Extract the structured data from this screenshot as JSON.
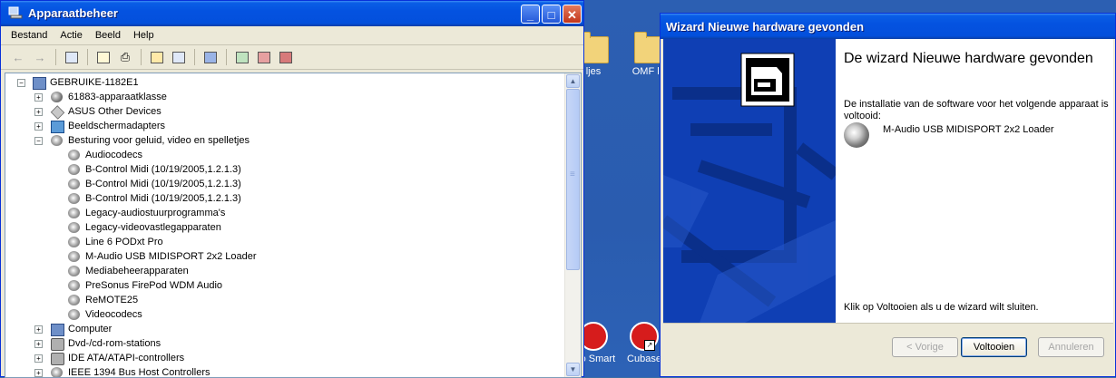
{
  "desktop": {
    "icons": [
      {
        "label": "ljes"
      },
      {
        "label": "OMF lie"
      },
      {
        "label": "ero Smart"
      },
      {
        "label": "Cubase"
      }
    ]
  },
  "devmgr": {
    "title": "Apparaatbeheer",
    "menu": [
      "Bestand",
      "Actie",
      "Beeld",
      "Help"
    ],
    "tree": {
      "root": "GEBRUIKE-1182E1",
      "items": [
        {
          "label": "61883-apparaatklasse",
          "expanded": false
        },
        {
          "label": "ASUS Other Devices",
          "expanded": false
        },
        {
          "label": "Beeldschermadapters",
          "expanded": false
        },
        {
          "label": "Besturing voor geluid, video en spelletjes",
          "expanded": true,
          "children": [
            "Audiocodecs",
            "B-Control Midi (10/19/2005,1.2.1.3)",
            "B-Control Midi (10/19/2005,1.2.1.3)",
            "B-Control Midi (10/19/2005,1.2.1.3)",
            "Legacy-audiostuurprogramma's",
            "Legacy-videovastlegapparaten",
            "Line 6 PODxt Pro",
            "M-Audio USB MIDISPORT 2x2 Loader",
            "Mediabeheerapparaten",
            "PreSonus FirePod WDM Audio",
            "ReMOTE25",
            "Videocodecs"
          ]
        },
        {
          "label": "Computer",
          "expanded": false
        },
        {
          "label": "Dvd-/cd-rom-stations",
          "expanded": false
        },
        {
          "label": "IDE ATA/ATAPI-controllers",
          "expanded": false
        },
        {
          "label": "IEEE 1394 Bus Host Controllers",
          "expanded": false
        }
      ]
    }
  },
  "wizard": {
    "title": "Wizard Nieuwe hardware gevonden",
    "heading": "De wizard Nieuwe hardware gevonden",
    "description": "De installatie van de software voor het volgende apparaat is voltooid:",
    "device_name": "M-Audio USB MIDISPORT 2x2 Loader",
    "finish_text": "Klik op Voltooien als u de wizard wilt sluiten.",
    "buttons": {
      "back": "< Vorige",
      "finish": "Voltooien",
      "cancel": "Annuleren"
    }
  },
  "colors": {
    "titlebar": "#0452e0",
    "wizard_panel": "#0f3fb4",
    "window_face": "#ece9d8"
  }
}
